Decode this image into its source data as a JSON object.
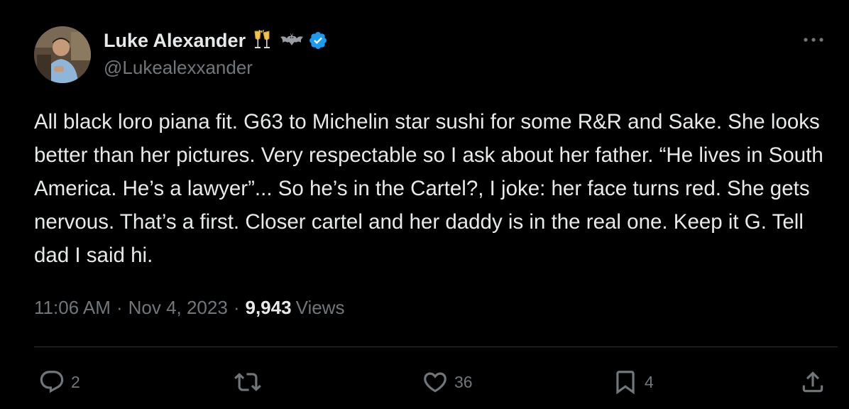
{
  "author": {
    "display_name": "Luke Alexander",
    "emoji_1": "clinking-glasses-emoji",
    "emoji_2": "bat-emoji",
    "verified": true,
    "handle": "@Lukealexxander"
  },
  "tweet": {
    "text": "All black loro piana fit. G63 to Michelin star sushi for some R&R and Sake. She looks better than her pictures. Very respectable so I ask about her father. “He lives in South America. He’s a lawyer”... So he’s in the Cartel?, I joke: her face turns red. She gets nervous. That’s a first. Closer cartel and her daddy is in the real one. Keep it G. Tell dad I said hi.",
    "time": "11:06 AM",
    "separator": "·",
    "date": "Nov 4, 2023",
    "views_count": "9,943",
    "views_label": "Views"
  },
  "actions": {
    "reply_count": "2",
    "repost_count": "",
    "like_count": "36",
    "bookmark_count": "4"
  },
  "colors": {
    "background": "#000000",
    "text_primary": "#e7e9ea",
    "text_secondary": "#71767b",
    "verified_blue": "#1d9bf0",
    "divider": "#2f3336"
  },
  "icons": {
    "more": "more-horizontal-icon",
    "reply": "reply-icon",
    "repost": "repost-icon",
    "like": "heart-icon",
    "bookmark": "bookmark-icon",
    "share": "share-icon",
    "verified": "verified-badge-icon"
  }
}
